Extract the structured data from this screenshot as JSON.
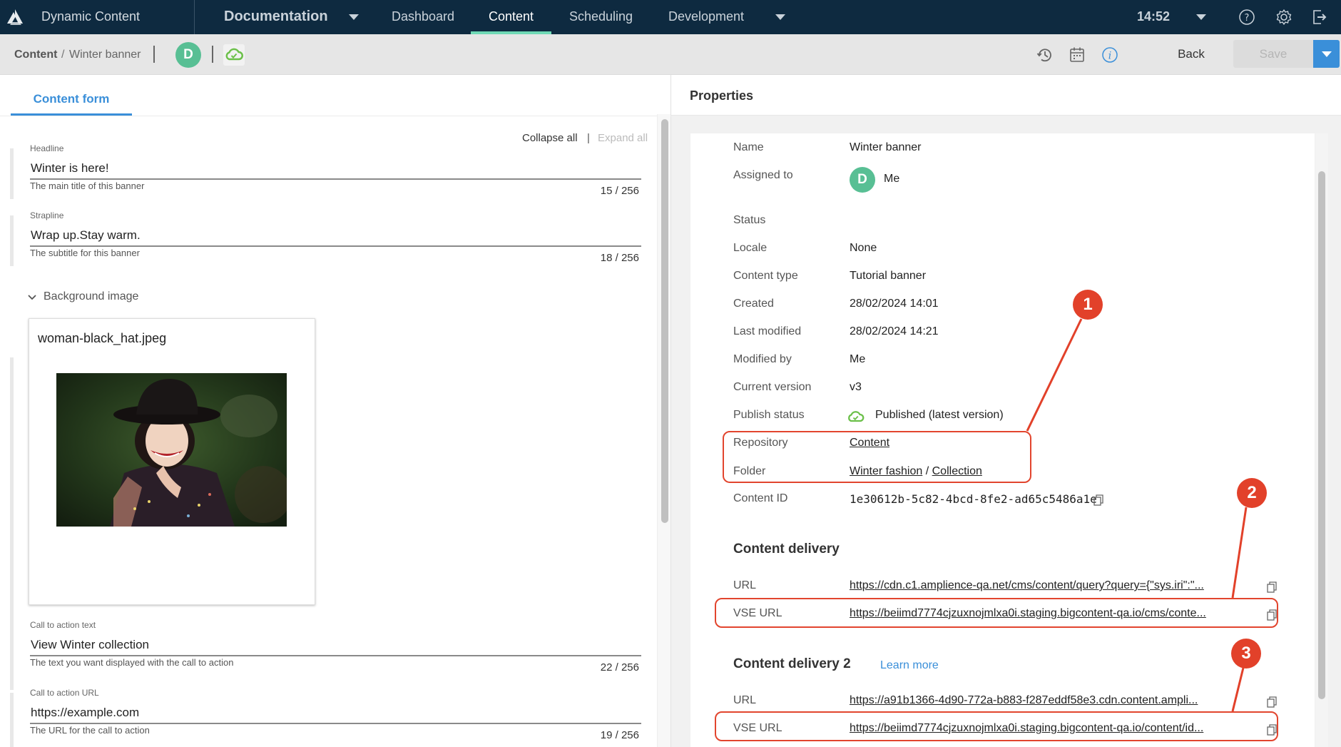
{
  "topbar": {
    "app_name": "Dynamic Content",
    "hub_name": "Documentation",
    "nav": [
      {
        "label": "Dashboard",
        "active": false
      },
      {
        "label": "Content",
        "active": true
      },
      {
        "label": "Scheduling",
        "active": false
      },
      {
        "label": "Development",
        "active": false
      }
    ],
    "time": "14:52",
    "icons": [
      "logo-icon",
      "help-icon",
      "gear-icon",
      "logout-icon"
    ],
    "accent_color": "#6fd9b5",
    "background_color": "#0e2a40"
  },
  "toolbar": {
    "breadcrumb_root": "Content",
    "breadcrumb_separator": "/",
    "breadcrumb_current": "Winter banner",
    "avatar_initial": "D",
    "icons": [
      "history-icon",
      "calendar-icon",
      "info-icon"
    ],
    "back_label": "Back",
    "save_label": "Save"
  },
  "form": {
    "tab_label": "Content form",
    "collapse_all": "Collapse all",
    "separator": "|",
    "expand_all": "Expand all",
    "fields": [
      {
        "label": "Headline",
        "value": "Winter is here!",
        "help": "The main title of this banner",
        "count": "15 / 256"
      },
      {
        "label": "Strapline",
        "value": "Wrap up.Stay warm.",
        "help": "The subtitle for this banner",
        "count": "18 / 256"
      },
      {
        "label": "Call to action text",
        "value": "View Winter collection",
        "help": "The text you want displayed with the call to action",
        "count": "22 / 256"
      },
      {
        "label": "Call to action URL",
        "value": "https://example.com",
        "help": "The URL for the call to action",
        "count": "19 / 256"
      }
    ],
    "background_image": {
      "section_label": "Background image",
      "file_name": "woman-black_hat.jpeg"
    }
  },
  "properties": {
    "title": "Properties",
    "rows": {
      "name": {
        "label": "Name",
        "value": "Winter banner"
      },
      "assigned": {
        "label": "Assigned to",
        "avatar": "D",
        "value": "Me"
      },
      "status": {
        "label": "Status",
        "value": ""
      },
      "locale": {
        "label": "Locale",
        "value": "None"
      },
      "content_type": {
        "label": "Content type",
        "value": "Tutorial banner"
      },
      "created": {
        "label": "Created",
        "value": "28/02/2024 14:01"
      },
      "last_modified": {
        "label": "Last modified",
        "value": "28/02/2024 14:21"
      },
      "modified_by": {
        "label": "Modified by",
        "value": "Me"
      },
      "current_version": {
        "label": "Current version",
        "value": "v3"
      },
      "publish_status": {
        "label": "Publish status",
        "value": "Published (latest version)"
      },
      "repository": {
        "label": "Repository",
        "value": "Content"
      },
      "folder": {
        "label": "Folder",
        "value_1": "Winter fashion",
        "sep": "/",
        "value_2": "Collection"
      },
      "content_id": {
        "label": "Content ID",
        "value": "1e30612b-5c82-4bcd-8fe2-ad65c5486a1e"
      }
    },
    "content_delivery": {
      "title": "Content delivery",
      "url_label": "URL",
      "url": "https://cdn.c1.amplience-qa.net/cms/content/query?query={\"sys.iri\":\"...",
      "vse_label": "VSE URL",
      "vse_url": "https://beiimd7774cjzuxnojmlxa0i.staging.bigcontent-qa.io/cms/conte..."
    },
    "content_delivery_2": {
      "title": "Content delivery 2",
      "learn_more": "Learn more",
      "url_label": "URL",
      "url": "https://a91b1366-4d90-772a-b883-f287eddf58e3.cdn.content.ampli...",
      "vse_label": "VSE URL",
      "vse_url": "https://beiimd7774cjzuxnojmlxa0i.staging.bigcontent-qa.io/content/id..."
    },
    "published_color": "#6cc04a",
    "link_color": "#3a8fd9"
  },
  "annotations": {
    "color": "#e2412a",
    "badges": [
      "1",
      "2",
      "3"
    ]
  }
}
